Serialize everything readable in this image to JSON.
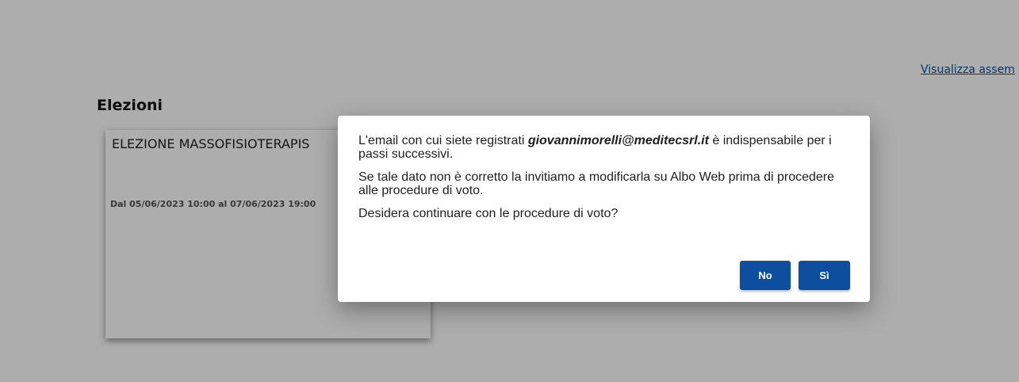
{
  "header": {
    "view_link": "Visualizza assem"
  },
  "section": {
    "title": "Elezioni"
  },
  "election_card": {
    "title": "ELEZIONE MASSOFISIOTERAPIS",
    "dates": "Dal 05/06/2023 10:00 al 07/06/2023 19:00"
  },
  "dialog": {
    "line1_before": "L'email con cui siete registrati ",
    "email": "giovannimorelli@meditecsrl.it",
    "line1_after": " è indispensabile per i passi successivi.",
    "paragraph2": "Se tale dato non è corretto la invitiamo a modificarla su Albo Web prima di procedere alle procedure di voto.",
    "paragraph3": "Desidera continuare con le procedure di voto?",
    "no_label": "No",
    "yes_label": "Sì"
  },
  "colors": {
    "button_primary": "#0d4f9e",
    "link": "#0b4f9c",
    "overlay": "rgba(0,0,0,0.32)"
  }
}
